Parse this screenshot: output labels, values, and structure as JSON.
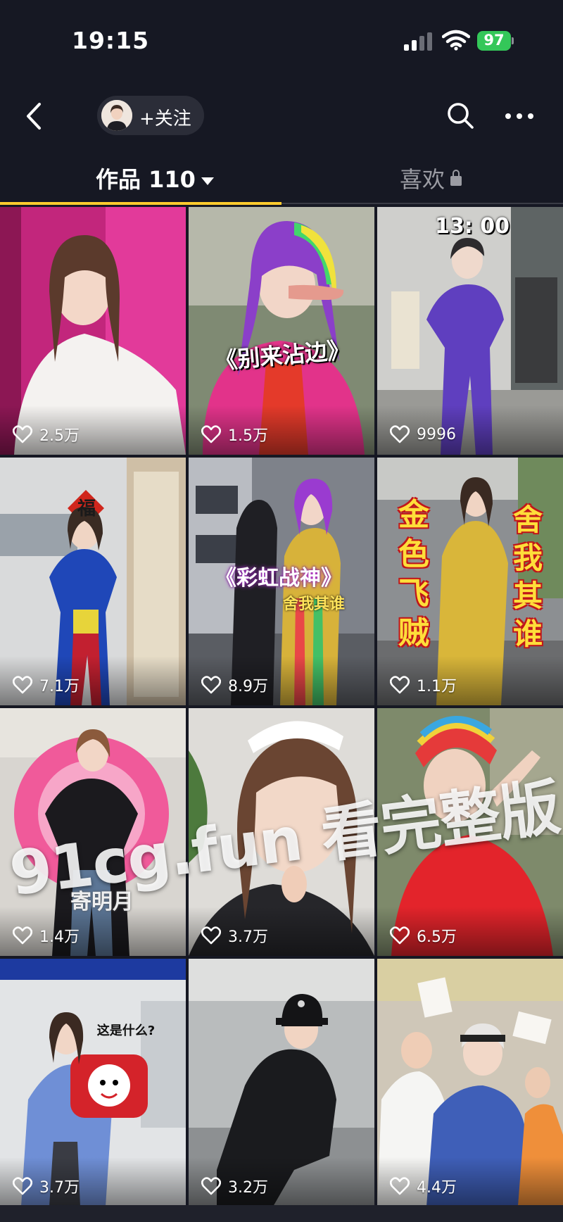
{
  "status_bar": {
    "time": "19:15",
    "battery": "97"
  },
  "nav": {
    "follow_label": "+关注"
  },
  "tabs": {
    "works_label": "作品 110",
    "likes_label": "喜欢"
  },
  "videos": [
    {
      "likes": "2.5万"
    },
    {
      "likes": "1.5万",
      "caption": "《别来沾边》"
    },
    {
      "likes": "9996",
      "caption": "13: 00"
    },
    {
      "likes": "7.1万",
      "caption": "福"
    },
    {
      "likes": "8.9万",
      "caption": "《彩虹战神》",
      "subcaption": "舍我其谁"
    },
    {
      "likes": "1.1万",
      "caption": "金色飞贼",
      "subcaption": "舍我其谁"
    },
    {
      "likes": "1.4万",
      "caption": "寄明月"
    },
    {
      "likes": "3.7万"
    },
    {
      "likes": "6.5万"
    },
    {
      "likes": "3.7万",
      "caption": "这是什么?"
    },
    {
      "likes": "3.2万"
    },
    {
      "likes": "4.4万"
    }
  ],
  "watermark": "91cg.fun 看完整版",
  "colors": {
    "background": "#161823",
    "battery": "#34c759",
    "tab_underline": "#ffcb2e"
  }
}
